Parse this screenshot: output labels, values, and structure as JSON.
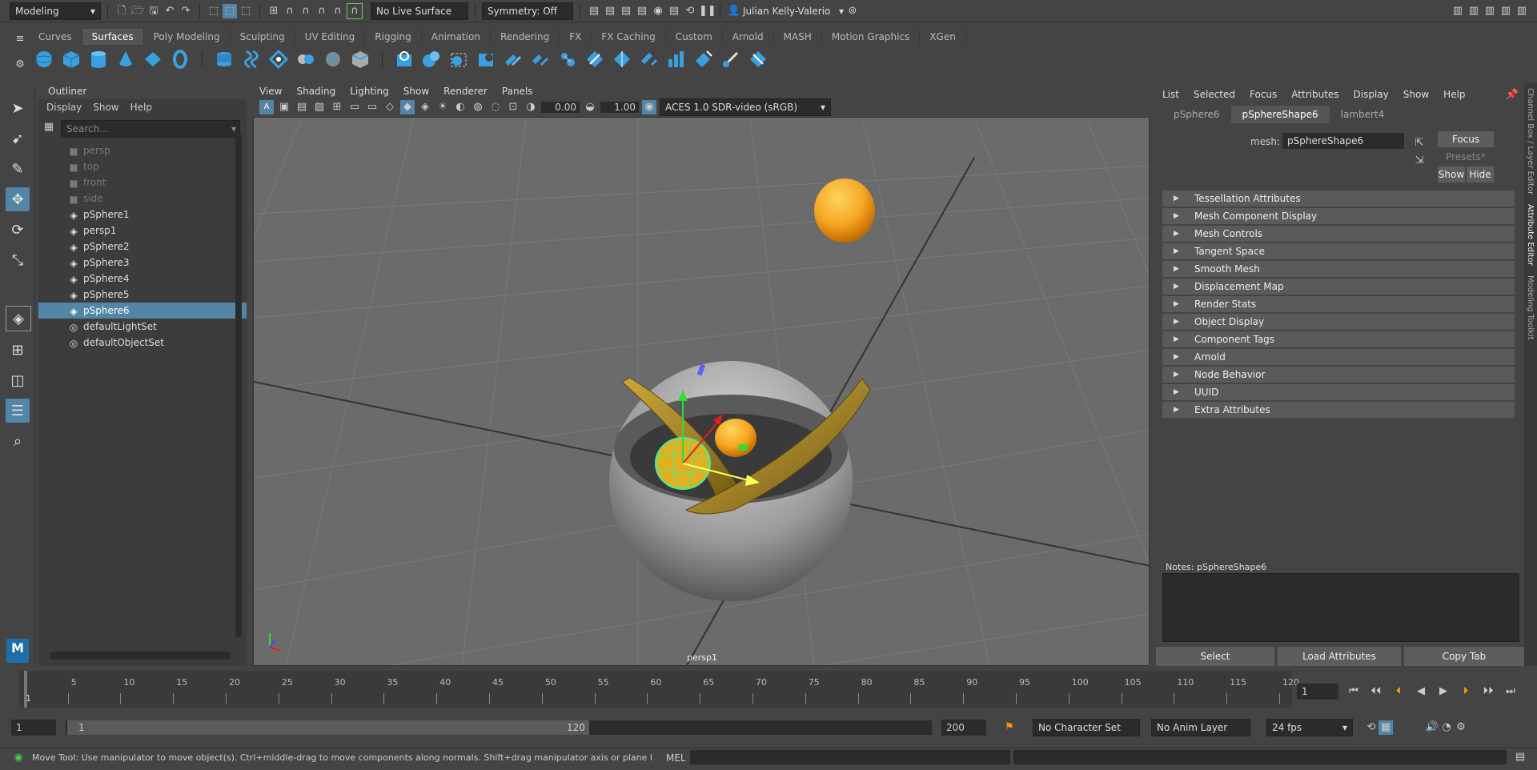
{
  "status_line": {
    "mode": "Modeling",
    "live_surface": "No Live Surface",
    "symmetry": "Symmetry: Off",
    "user": "Julian Kelly-Valerio"
  },
  "shelf": {
    "tabs": [
      "Curves",
      "Surfaces",
      "Poly Modeling",
      "Sculpting",
      "UV Editing",
      "Rigging",
      "Animation",
      "Rendering",
      "FX",
      "FX Caching",
      "Custom",
      "Arnold",
      "MASH",
      "Motion Graphics",
      "XGen"
    ],
    "active_tab": "Surfaces"
  },
  "outliner": {
    "title": "Outliner",
    "menu": [
      "Display",
      "Show",
      "Help"
    ],
    "search_placeholder": "Search...",
    "items": [
      {
        "label": "persp",
        "icon": "camera-icon",
        "dim": true
      },
      {
        "label": "top",
        "icon": "camera-icon",
        "dim": true
      },
      {
        "label": "front",
        "icon": "camera-icon",
        "dim": true
      },
      {
        "label": "side",
        "icon": "camera-icon",
        "dim": true
      },
      {
        "label": "pSphere1",
        "icon": "mesh-icon"
      },
      {
        "label": "persp1",
        "icon": "mesh-icon"
      },
      {
        "label": "pSphere2",
        "icon": "mesh-icon"
      },
      {
        "label": "pSphere3",
        "icon": "mesh-icon"
      },
      {
        "label": "pSphere4",
        "icon": "mesh-icon"
      },
      {
        "label": "pSphere5",
        "icon": "mesh-icon"
      },
      {
        "label": "pSphere6",
        "icon": "mesh-icon",
        "selected": true
      },
      {
        "label": "defaultLightSet",
        "icon": "set-icon"
      },
      {
        "label": "defaultObjectSet",
        "icon": "set-icon"
      }
    ]
  },
  "viewport": {
    "menu": [
      "View",
      "Shading",
      "Lighting",
      "Show",
      "Renderer",
      "Panels"
    ],
    "exposure": "0.00",
    "gamma": "1.00",
    "color_space": "ACES 1.0 SDR-video (sRGB)",
    "camera_label": "persp1"
  },
  "attribute_editor": {
    "menu": [
      "List",
      "Selected",
      "Focus",
      "Attributes",
      "Display",
      "Show",
      "Help"
    ],
    "tabs": [
      "pSphere6",
      "pSphereShape6",
      "lambert4"
    ],
    "active_tab": "pSphereShape6",
    "mesh_label": "mesh:",
    "mesh_value": "pSphereShape6",
    "focus": "Focus",
    "presets": "Presets*",
    "show": "Show",
    "hide": "Hide",
    "sections": [
      "Tessellation Attributes",
      "Mesh Component Display",
      "Mesh Controls",
      "Tangent Space",
      "Smooth Mesh",
      "Displacement Map",
      "Render Stats",
      "Object Display",
      "Component Tags",
      "Arnold",
      "Node Behavior",
      "UUID",
      "Extra Attributes"
    ],
    "notes_label": "Notes:  pSphereShape6",
    "buttons": [
      "Select",
      "Load Attributes",
      "Copy Tab"
    ]
  },
  "right_tabs": [
    "Channel Box / Layer Editor",
    "Attribute Editor",
    "Modeling Toolkit"
  ],
  "timeline": {
    "tick_labels": [
      "5",
      "10",
      "15",
      "20",
      "25",
      "30",
      "35",
      "40",
      "45",
      "50",
      "55",
      "60",
      "65",
      "70",
      "75",
      "80",
      "85",
      "90",
      "95",
      "100",
      "105",
      "110",
      "115",
      "120"
    ],
    "start": "1",
    "current_frame": "1"
  },
  "range": {
    "start": "1",
    "inner_start": "1",
    "inner_end": "120",
    "end": "200",
    "character_set": "No Character Set",
    "anim_layer": "No Anim Layer",
    "fps": "24 fps"
  },
  "command_line": {
    "help": "Move Tool: Use manipulator to move object(s). Ctrl+middle-drag to move components along normals. Shift+drag manipulator axis or plane handles to extrude components or c",
    "lang": "MEL"
  },
  "colors": {
    "selection": "#5285a6",
    "viewport_bg": "#6b6b6b",
    "orange_sphere": "#f5a623"
  }
}
